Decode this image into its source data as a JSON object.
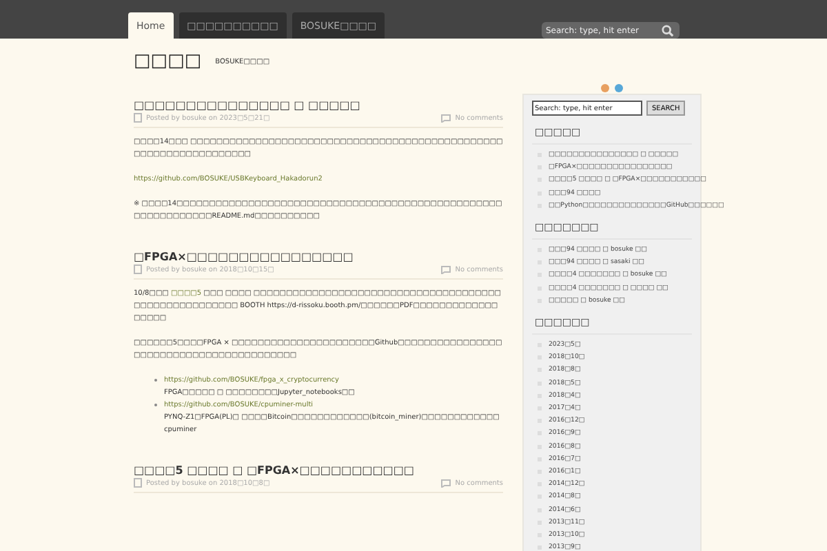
{
  "nav": {
    "tabs": [
      {
        "label": "Home",
        "selected": true
      },
      {
        "label": "□□□□□□□□□□",
        "selected": false
      },
      {
        "label": "BOSUKE□□□□",
        "selected": false
      }
    ],
    "search": {
      "placeholder": "Search: type, hit enter"
    }
  },
  "site": {
    "title": "□□□□",
    "tagline": "BOSUKE□□□□"
  },
  "posts": [
    {
      "title": "□□□□□□□□□□□□□□□ □ □□□□□",
      "posted": "Posted by bosuke on 2023□5□21□",
      "comments": "No comments",
      "blocks": [
        {
          "kind": "para",
          "segments": [
            {
              "kind": "text",
              "text": "□□□□14□□□ □□□□□□□□□□□□□□□□□□□□□□□□□□□□□□□□□□□□□□□□□□□□□□□□□□□□□□□□□□□□□□□□□□"
            }
          ]
        },
        {
          "kind": "para",
          "segments": [
            {
              "kind": "link",
              "text": "https://github.com/BOSUKE/USBKeyboard_Hakadorun2"
            }
          ]
        },
        {
          "kind": "para",
          "segments": [
            {
              "kind": "text",
              "text": "※ □□□□14□□□□□□□□□□□□□□□□□□□□□□□□□□□□□□□□□□□□□□□□□□□□□□□□□□□□□□□□□□□□□□README.md□□□□□□□□□□"
            }
          ]
        }
      ]
    },
    {
      "title": "□FPGA×□□□□□□□□□□□□□□□□",
      "posted": "Posted by bosuke on 2018□10□15□",
      "comments": "No comments",
      "blocks": [
        {
          "kind": "para",
          "segments": [
            {
              "kind": "text",
              "text": "10/8□□□ "
            },
            {
              "kind": "link",
              "text": "□□□□5"
            },
            {
              "kind": "text",
              "text": " □□□ □□□□ □□□□□□□□□□□□□□□□□□□□□□□□□□□□□□□□□□□□□□□□□□□□□□□□□□□□□□ BOOTH https://d-rissoku.booth.pm/□□□□□□PDF□□□□□□□□□□□□□□□□□□"
            }
          ]
        },
        {
          "kind": "para",
          "segments": [
            {
              "kind": "text",
              "text": "□□□□□□5□□□□FPGA × □□□□□□□□□□□□□□□□□□□□□□Github□□□□□□□□□□□□□□□□□□□□□□□□□□□□□□□□□□□□□□□□□"
            }
          ]
        },
        {
          "kind": "list",
          "items": [
            {
              "link": "https://github.com/BOSUKE/fpga_x_cryptocurrency",
              "text": "FPGA□□□□□ □ □□□□□□□□Jupyter_notebooks□□"
            },
            {
              "link": "https://github.com/BOSUKE/cpuminer-multi",
              "text": "PYNQ-Z1□FPGA(PL)□ □□□□Bitcoin□□□□□□□□□□□□(bitcoin_miner)□□□□□□□□□□□□ cpuminer"
            }
          ]
        }
      ]
    },
    {
      "title": "□□□□5 □□□□ □ □FPGA×□□□□□□□□□□□",
      "posted": "Posted by bosuke on 2018□10□8□",
      "comments": "No comments"
    }
  ],
  "sidebar": {
    "search": {
      "placeholder": "Search: type, hit enter",
      "button": "SEARCH"
    },
    "sections": [
      {
        "title": "□□□□□",
        "items": [
          "□□□□□□□□□□□□□□□ □ □□□□□",
          "□FPGA×□□□□□□□□□□□□□□□□",
          "□□□□5 □□□□ □ □FPGA×□□□□□□□□□□□",
          "□□□94 □□□□",
          "□□Python□□□□□□□□□□□□□□GitHub□□□□□□"
        ]
      },
      {
        "title": "□□□□□□□",
        "items": [
          "□□□94 □□□□ □ bosuke □□",
          "□□□94 □□□□ □ sasaki □□",
          "□□□□4 □□□□□□□ □ bosuke □□",
          "□□□□4 □□□□□□□ □ □□□□ □□",
          "□□□□□ □ bosuke □□"
        ]
      },
      {
        "title": "□□□□□□",
        "items": [
          "2023□5□",
          "2018□10□",
          "2018□8□",
          "2018□5□",
          "2018□4□",
          "2017□4□",
          "2016□12□",
          "2016□9□",
          "2016□8□",
          "2016□7□",
          "2016□1□",
          "2014□12□",
          "2014□8□",
          "2014□6□",
          "2013□11□",
          "2013□10□",
          "2013□9□"
        ]
      }
    ]
  }
}
